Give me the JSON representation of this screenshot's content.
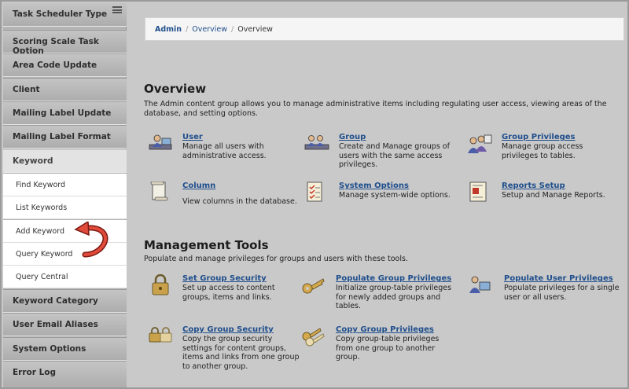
{
  "sidebar": {
    "items_top": [
      "Task Scheduler Type",
      "Scoring Scale Task Option",
      "Area Code Update",
      "Client",
      "Mailing Label Update",
      "Mailing Label Format"
    ],
    "active_group": "Keyword",
    "sub_items": [
      "Find Keyword",
      "List Keywords",
      "Add Keyword",
      "Query Keyword",
      "Query Central"
    ],
    "items_bottom": [
      "Keyword Category",
      "User Email Aliases",
      "System Options",
      "Error Log"
    ]
  },
  "breadcrumb": {
    "admin": "Admin",
    "overview_link": "Overview",
    "current": "Overview",
    "separator": "/"
  },
  "overview": {
    "title": "Overview",
    "description": "The Admin content group allows you to manage administrative items including regulating user access, viewing areas of the database, and setting options.",
    "tiles": [
      {
        "title": "User",
        "text": "Manage all users with administrative access.",
        "icon": "user-icon"
      },
      {
        "title": "Group",
        "text": "Create and Manage groups of users with the same access privileges.",
        "icon": "group-icon"
      },
      {
        "title": "Group Privileges",
        "text": "Manage group access privileges to tables.",
        "icon": "group-privileges-icon"
      },
      {
        "title": "Column",
        "text": "View columns in the database.",
        "icon": "column-icon"
      },
      {
        "title": "System Options",
        "text": "Manage system-wide options.",
        "icon": "system-options-icon"
      },
      {
        "title": "Reports Setup",
        "text": "Setup and Manage Reports.",
        "icon": "reports-setup-icon"
      }
    ]
  },
  "management": {
    "title": "Management Tools",
    "description": "Populate and manage privileges for groups and users with these tools.",
    "tiles": [
      {
        "title": "Set Group Security",
        "text": "Set up access to content groups, items and links.",
        "icon": "padlock-icon"
      },
      {
        "title": "Populate Group Privileges",
        "text": "Initialize group-table privileges for newly added groups and tables.",
        "icon": "key-icon"
      },
      {
        "title": "Populate User Privileges",
        "text": "Populate privileges for a single user or all users.",
        "icon": "user-privileges-icon"
      },
      {
        "title": "Copy Group Security",
        "text": "Copy the group security settings for content groups, items and links from one group to another group.",
        "icon": "copy-padlock-icon"
      },
      {
        "title": "Copy Group Privileges",
        "text": "Copy group-table privileges from one group to another group.",
        "icon": "copy-key-icon"
      }
    ]
  },
  "colors": {
    "link": "#1f4e8c",
    "arrow": "#c0392b"
  }
}
